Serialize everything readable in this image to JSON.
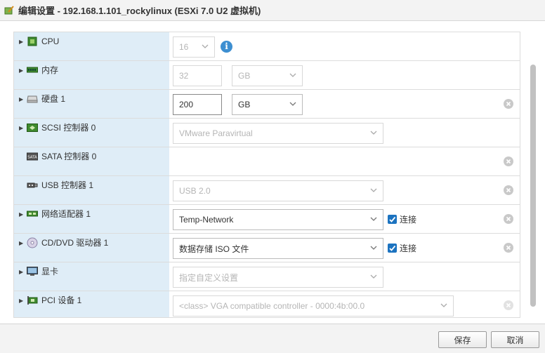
{
  "window": {
    "title": "编辑设置 - 192.168.1.101_rockylinux (ESXi 7.0 U2 虚拟机)"
  },
  "rows": [
    {
      "label": "CPU",
      "icon": "cpu-icon",
      "value": "16"
    },
    {
      "label": "内存",
      "icon": "memory-icon",
      "value": "32",
      "unit": "GB"
    },
    {
      "label": "硬盘 1",
      "icon": "hard-disk-icon",
      "value": "200",
      "unit": "GB"
    },
    {
      "label": "SCSI 控制器 0",
      "icon": "scsi-controller-icon",
      "value": "VMware Paravirtual"
    },
    {
      "label": "SATA 控制器 0",
      "icon": "sata-controller-icon"
    },
    {
      "label": "USB 控制器 1",
      "icon": "usb-icon",
      "value": "USB 2.0"
    },
    {
      "label": "网络适配器 1",
      "icon": "network-adapter-icon",
      "value": "Temp-Network",
      "checkbox": "连接"
    },
    {
      "label": "CD/DVD 驱动器 1",
      "icon": "cd-dvd-icon",
      "value": "数据存储 ISO 文件",
      "checkbox": "连接"
    },
    {
      "label": "显卡",
      "icon": "display-icon",
      "value": "指定自定义设置"
    },
    {
      "label": "PCI 设备 1",
      "icon": "pci-device-icon",
      "value": "<class> VGA compatible controller - 0000:4b:00.0"
    }
  ],
  "footer": {
    "save_label": "保存",
    "cancel_label": "取消"
  },
  "colors": {
    "label_column": "#dfedf7",
    "checkbox": "#1c73c0",
    "info": "#3d8fd1"
  }
}
